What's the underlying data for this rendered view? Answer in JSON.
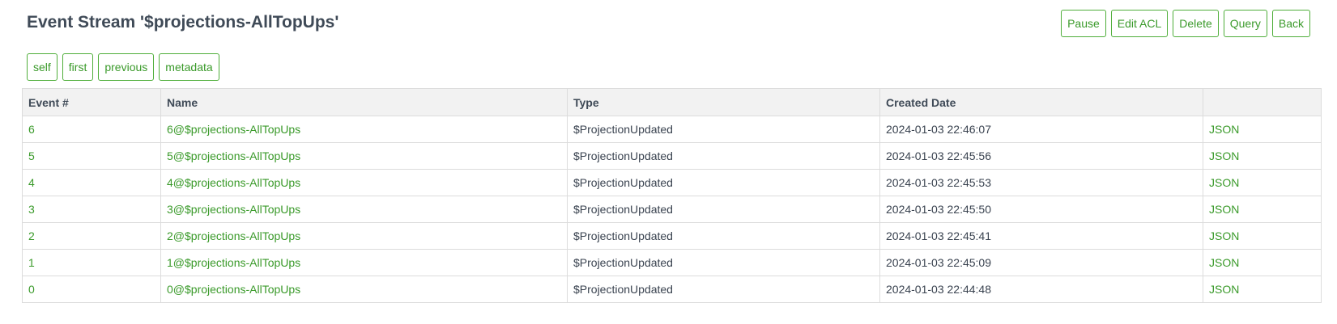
{
  "header": {
    "title": "Event Stream '$projections-AllTopUps'"
  },
  "actions": {
    "pause": "Pause",
    "edit_acl": "Edit ACL",
    "delete": "Delete",
    "query": "Query",
    "back": "Back"
  },
  "nav": {
    "self": "self",
    "first": "first",
    "previous": "previous",
    "metadata": "metadata"
  },
  "table": {
    "columns": [
      "Event #",
      "Name",
      "Type",
      "Created Date",
      ""
    ],
    "rows": [
      {
        "event_number": "6",
        "name": "6@$projections-AllTopUps",
        "type": "$ProjectionUpdated",
        "created": "2024-01-03 22:46:07",
        "link": "JSON"
      },
      {
        "event_number": "5",
        "name": "5@$projections-AllTopUps",
        "type": "$ProjectionUpdated",
        "created": "2024-01-03 22:45:56",
        "link": "JSON"
      },
      {
        "event_number": "4",
        "name": "4@$projections-AllTopUps",
        "type": "$ProjectionUpdated",
        "created": "2024-01-03 22:45:53",
        "link": "JSON"
      },
      {
        "event_number": "3",
        "name": "3@$projections-AllTopUps",
        "type": "$ProjectionUpdated",
        "created": "2024-01-03 22:45:50",
        "link": "JSON"
      },
      {
        "event_number": "2",
        "name": "2@$projections-AllTopUps",
        "type": "$ProjectionUpdated",
        "created": "2024-01-03 22:45:41",
        "link": "JSON"
      },
      {
        "event_number": "1",
        "name": "1@$projections-AllTopUps",
        "type": "$ProjectionUpdated",
        "created": "2024-01-03 22:45:09",
        "link": "JSON"
      },
      {
        "event_number": "0",
        "name": "0@$projections-AllTopUps",
        "type": "$ProjectionUpdated",
        "created": "2024-01-03 22:44:48",
        "link": "JSON"
      }
    ]
  },
  "colors": {
    "accent": "#3a9a2a",
    "border_accent": "#4fae3a",
    "header_bg": "#f2f2f2",
    "text": "#3a4350"
  }
}
